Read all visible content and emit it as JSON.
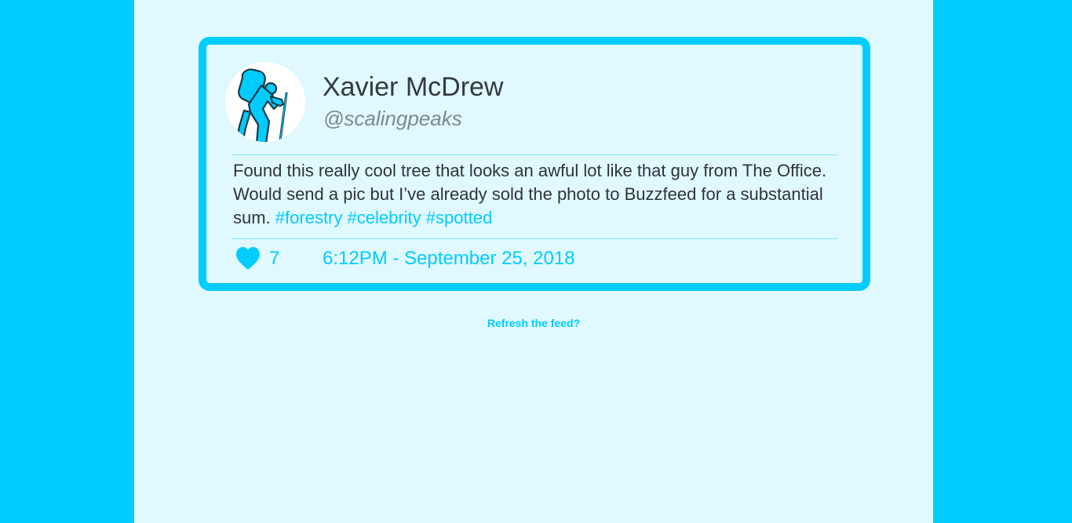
{
  "tweet": {
    "user_name": "Xavier McDrew",
    "user_handle": "@scalingpeaks",
    "avatar_icon": "hiker-icon",
    "text_segments": [
      {
        "text": "Found this really cool tree that looks an awful lot like that guy from The Office. Would send a pic but I’ve already sold the photo to Buzzfeed for a substantial sum. ",
        "type": "text"
      },
      {
        "text": "#forestry",
        "type": "hashtag"
      },
      {
        "text": " ",
        "type": "text"
      },
      {
        "text": "#celebrity",
        "type": "hashtag"
      },
      {
        "text": " ",
        "type": "text"
      },
      {
        "text": "#spotted",
        "type": "hashtag"
      }
    ],
    "like_icon": "heart-icon",
    "like_count": "7",
    "timestamp": "6:12PM - September 25, 2018"
  },
  "feed": {
    "refresh_label": "Refresh the feed?"
  },
  "colors": {
    "accent": "#00ccff",
    "page_background": "#e0f9ff",
    "outer_background": "#00ccff",
    "text": "#2e3438",
    "handle_text": "#7a8a90"
  }
}
